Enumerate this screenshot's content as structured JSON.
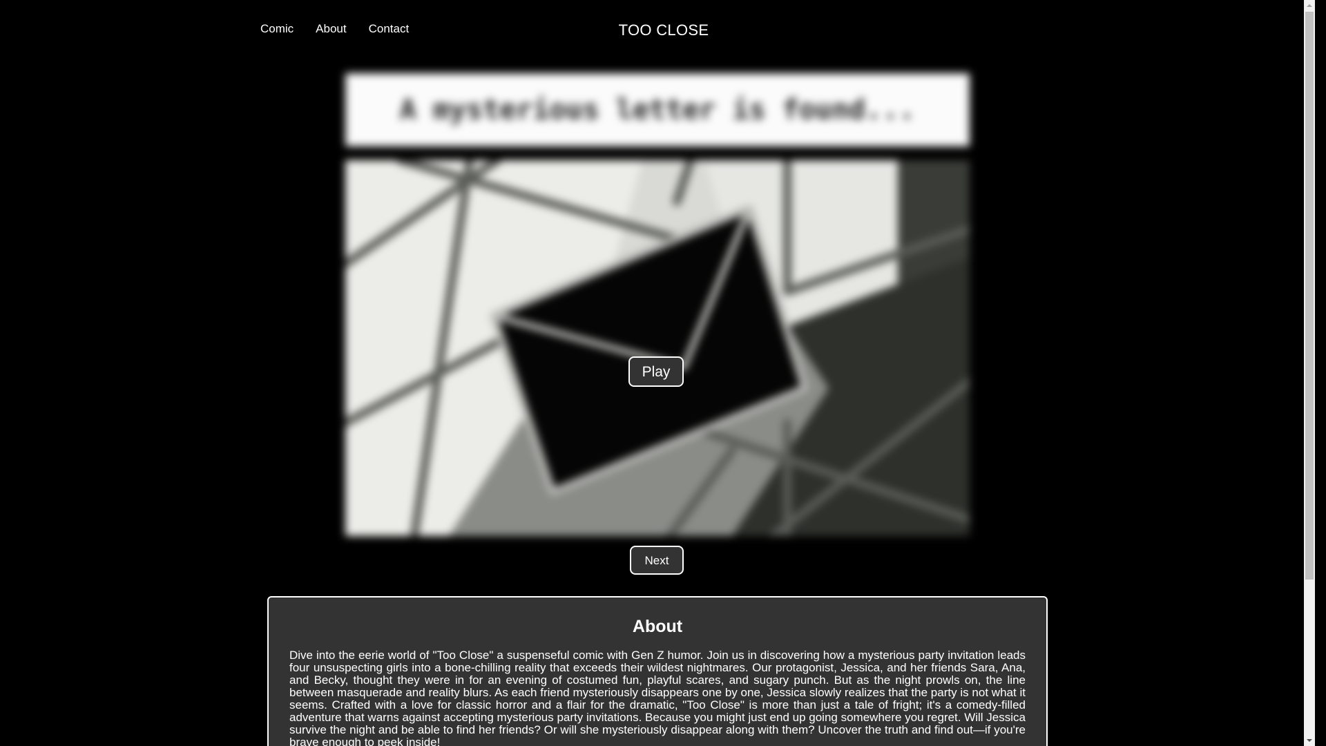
{
  "nav": {
    "items": [
      "Comic",
      "About",
      "Contact"
    ]
  },
  "site": {
    "title": "TOO CLOSE"
  },
  "panel": {
    "caption": "A mysterious letter is found...",
    "image": "envelope-on-window-illustration"
  },
  "controls": {
    "play_label": "Play",
    "next_label": "Next"
  },
  "about": {
    "heading": "About",
    "body": "Dive into the eerie world of \"Too Close\" a suspenseful comic with Gen Z humor. Join us in discovering how a mysterious party invitation leads four unsuspecting girls into a bone-chilling reality that exceeds their wildest nightmares. Our protagonist, Jessica, and her friends Sara, Ana, and Becky, thought they were in for an evening of costumed fun, playful scares, and sugary punch. But as the night prowls on, the line between masquerade and reality blurs. As each friend mysteriously disappears one by one, Jessica slowly realizes that the party is not what it seems. Crafted with a love for classic horror and a flair for the dramatic, \"Too Close\" is more than just a tale of fright; it's a comedy-filled adventure that warns against accepting mysterious party invitations. Because you might just end up going somewhere you regret. Will Jessica survive the night and be able to find her friends? Or will she mysteriously disappear along with them? Uncover the truth and find out—if you're brave enough to peek inside!"
  },
  "colors": {
    "background": "#000000",
    "button_bg": "#333333",
    "about_bg": "#333333",
    "text": "#ffffff"
  }
}
